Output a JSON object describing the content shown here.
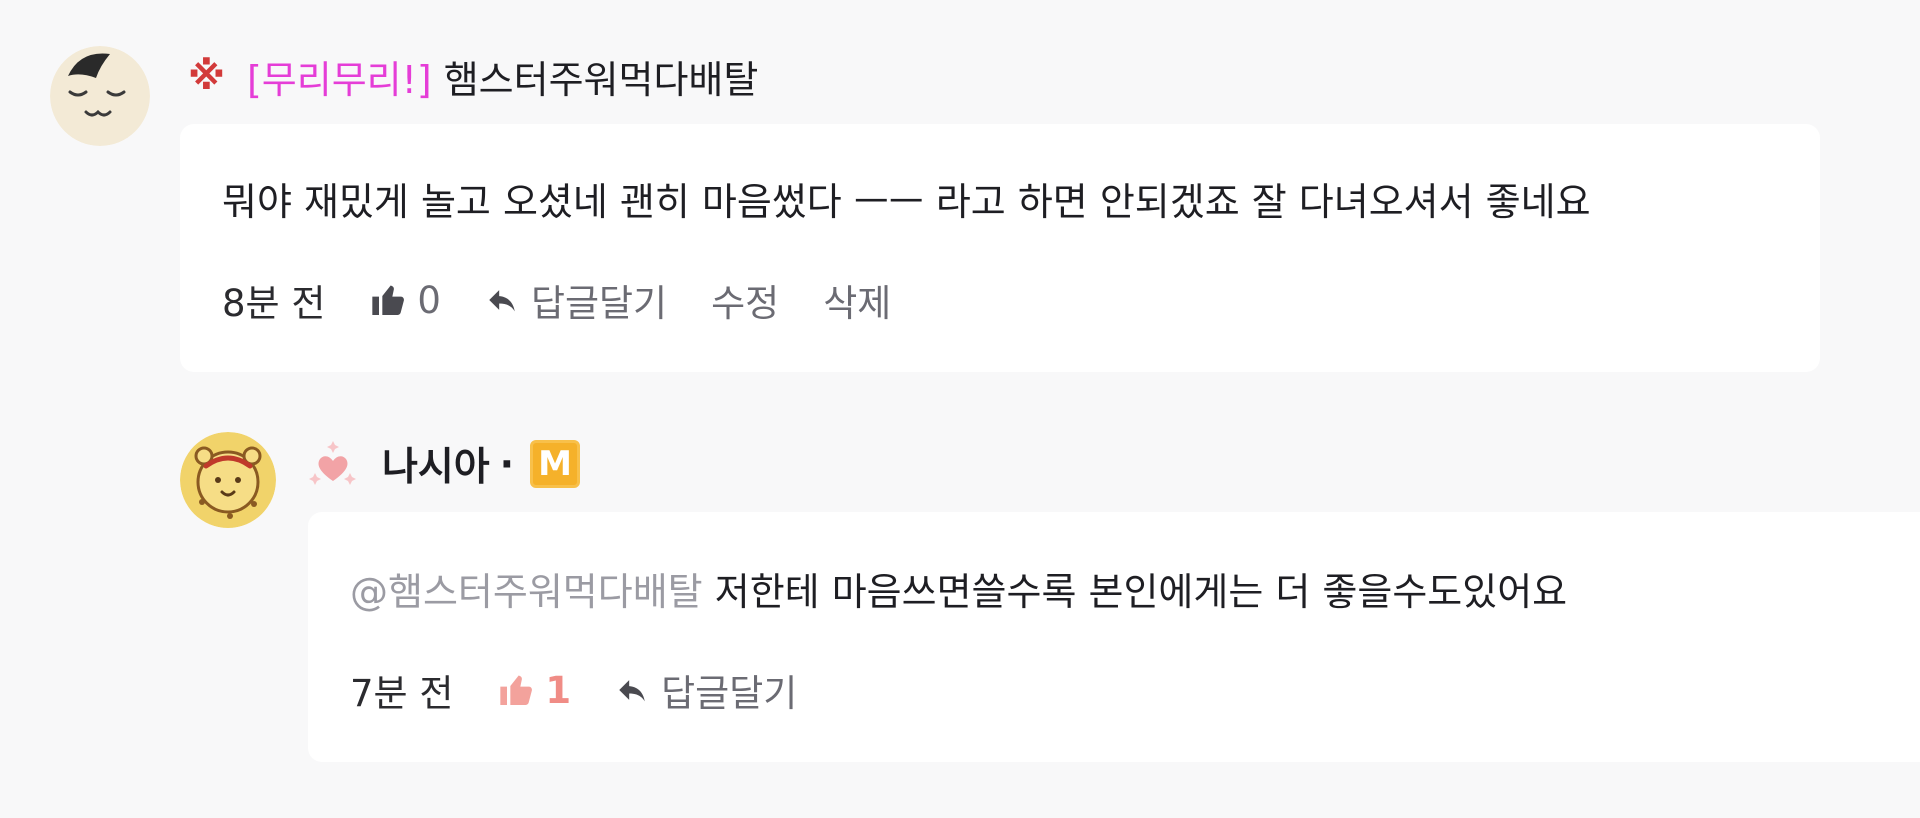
{
  "comments": [
    {
      "badge_mark": "※",
      "title_tag": "[무리무리!]",
      "nickname": "햄스터주워먹다배탈",
      "text": "뭐야 재밌게 놀고 오셨네 괜히 마음썼다 ㅡㅡ 라고 하면 안되겠죠 잘 다녀오셔서 좋네요",
      "time": "8분 전",
      "likes": "0",
      "reply_label": "답글달기",
      "edit_label": "수정",
      "delete_label": "삭제"
    }
  ],
  "reply": {
    "nickname": "나시아",
    "separator": "·",
    "badge_label": "M",
    "mention": "@햄스터주워먹다배탈",
    "text": " 저한테 마음쓰면쓸수록 본인에게는 더 좋을수도있어요",
    "time": "7분 전",
    "likes": "1",
    "reply_label": "답글달기"
  },
  "colors": {
    "page_background": "#f8f8f9",
    "bubble_background": "#ffffff",
    "title_tag": "#e53dd7",
    "badge_mark": "#d23a3a",
    "liked": "#f08c86",
    "m_badge": "#f5b12a",
    "mention": "#9b9ba3"
  },
  "icons": {
    "like": "thumbs-up-icon",
    "reply": "reply-arrow-icon",
    "sparkle": "sparkle-heart-icon",
    "avatar_1": "sleepy-face-avatar",
    "avatar_2": "bear-avatar"
  }
}
